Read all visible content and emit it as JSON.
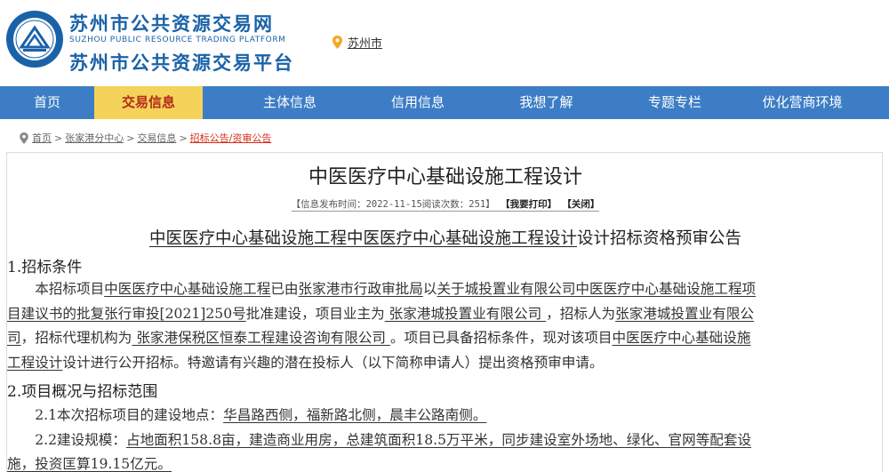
{
  "header": {
    "brand_title": "苏州市公共资源交易网",
    "brand_en": "SUZHOU PUBLIC RESOURCE TRADING PLATFORM",
    "brand_subtitle": "苏州市公共资源交易平台",
    "location": "苏州市",
    "colors": {
      "brand": "#1a62a8",
      "nav_bg": "#3d7dc5",
      "nav_active_bg": "#f5d25a",
      "nav_active_text": "#b22b1b",
      "pin": "#f5a623"
    }
  },
  "nav": {
    "items": [
      {
        "label": "首页",
        "active": false
      },
      {
        "label": "交易信息",
        "active": true
      },
      {
        "label": "主体信息",
        "active": false
      },
      {
        "label": "信用信息",
        "active": false
      },
      {
        "label": "我想了解",
        "active": false
      },
      {
        "label": "专题专栏",
        "active": false
      },
      {
        "label": "优化营商环境",
        "active": false
      }
    ]
  },
  "breadcrumb": {
    "items": [
      "首页",
      "张家港分中心",
      "交易信息",
      "招标公告/资审公告"
    ],
    "separator": ">"
  },
  "article": {
    "title": "中医医疗中心基础设施工程设计",
    "meta": {
      "publish_label": "【信息发布时间：2022-11-15阅读次数：251】",
      "print_label": "【我要打印】",
      "close_label": "【关闭】"
    },
    "doc_heading": {
      "part1": "中医医疗中心基础设施工程中医医疗中心基础设施工程设计",
      "part2": "设计招标资格预审公告"
    },
    "section1": {
      "heading": "1.招标条件",
      "line1": [
        "　　本招标项目",
        "中医医疗中心基础设施工程",
        "已由",
        "张家港市行政审批局",
        "以",
        "关于城投置业有限公司中医医疗中心基础设施工程项"
      ],
      "line2": [
        "目建议书的批复张行审投[2021]250号",
        "批准建设，项目业主为",
        " 张家港城投置业有限公司 ",
        "，招标人为",
        "张家港城投置业有限公"
      ],
      "line3": [
        "司",
        "，招标代理机构为",
        " 张家港保税区恒泰工程建设咨询有限公司 ",
        "。项目已具备招标条件，现对该项目",
        "中医医疗中心基础设施"
      ],
      "line4": [
        "工程设计",
        "设计进行公开招标。特邀请有兴趣的潜在投标人（以下简称申请人）提出资格预审申请。"
      ]
    },
    "section2": {
      "heading": "2.项目概况与招标范围",
      "item1": [
        "　　2.1本次招标项目的建设地点：",
        "华昌路西侧，福新路北侧，晨丰公路南侧。"
      ],
      "item2_line1": [
        "　　2.2建设规模：",
        "占地面积158.8亩，建造商业用房，总建筑面积18.5万平米，同步建设室外场地、绿化、官网等配套设"
      ],
      "item2_line2": [
        "施，投资匡算19.15亿元。"
      ]
    }
  }
}
